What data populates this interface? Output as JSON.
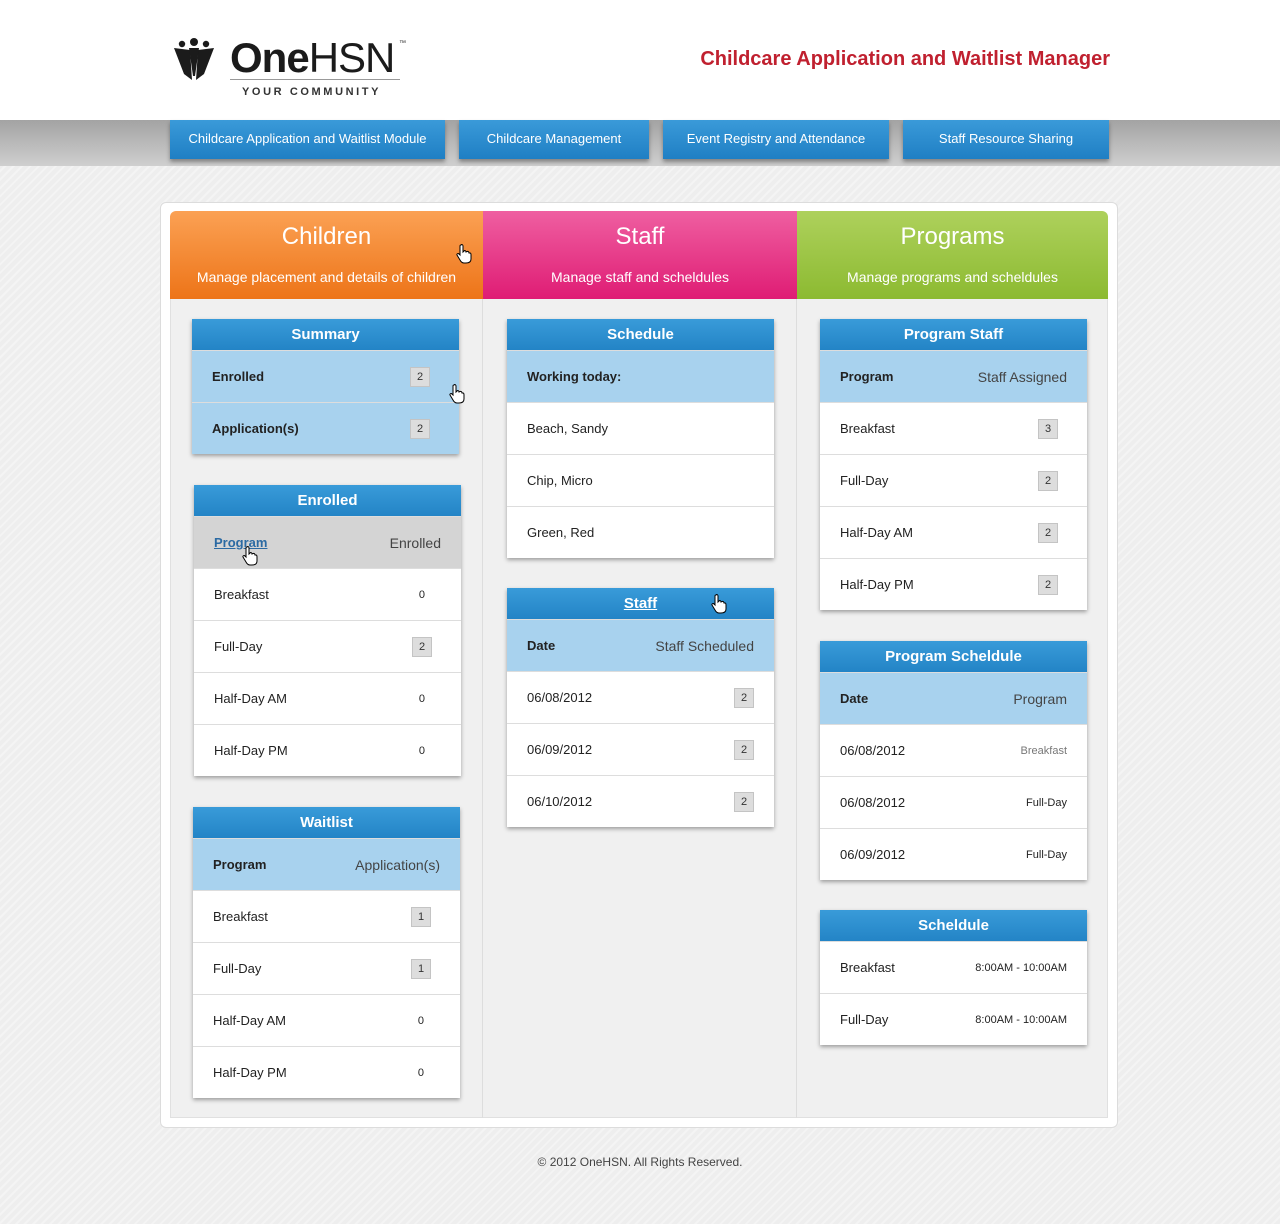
{
  "header": {
    "logo_one": "One",
    "logo_hsn": "HSN",
    "logo_tm": "™",
    "logo_tagline": "YOUR COMMUNITY",
    "app_title": "Childcare Application and Waitlist Manager"
  },
  "nav": [
    "Childcare Application and Waitlist Module",
    "Childcare Management",
    "Event Registry and Attendance",
    "Staff Resource Sharing"
  ],
  "columns": {
    "children": {
      "title": "Children",
      "subtitle": "Manage placement and details of children"
    },
    "staff": {
      "title": "Staff",
      "subtitle": "Manage staff and scheldules"
    },
    "programs": {
      "title": "Programs",
      "subtitle": "Manage programs and scheldules"
    }
  },
  "summary": {
    "title": "Summary",
    "rows": [
      {
        "label": "Enrolled",
        "count": "2"
      },
      {
        "label": "Application(s)",
        "count": "2"
      }
    ]
  },
  "enrolled": {
    "title": "Enrolled",
    "col_program": "Program",
    "col_value": "Enrolled",
    "rows": [
      {
        "program": "Breakfast",
        "count": "0"
      },
      {
        "program": "Full-Day",
        "count": "2"
      },
      {
        "program": "Half-Day AM",
        "count": "0"
      },
      {
        "program": "Half-Day PM",
        "count": "0"
      }
    ]
  },
  "waitlist": {
    "title": "Waitlist",
    "col_program": "Program",
    "col_value": "Application(s)",
    "rows": [
      {
        "program": "Breakfast",
        "count": "1"
      },
      {
        "program": "Full-Day",
        "count": "1"
      },
      {
        "program": "Half-Day AM",
        "count": "0"
      },
      {
        "program": "Half-Day PM",
        "count": "0"
      }
    ]
  },
  "staff_schedule": {
    "title": "Schedule",
    "subheader": "Working today:",
    "rows": [
      "Beach, Sandy",
      "Chip, Micro",
      "Green, Red"
    ]
  },
  "staff_table": {
    "title": "Staff",
    "col_date": "Date",
    "col_value": "Staff Scheduled",
    "rows": [
      {
        "date": "06/08/2012",
        "count": "2"
      },
      {
        "date": "06/09/2012",
        "count": "2"
      },
      {
        "date": "06/10/2012",
        "count": "2"
      }
    ]
  },
  "program_staff": {
    "title": "Program Staff",
    "col_program": "Program",
    "col_value": "Staff Assigned",
    "rows": [
      {
        "program": "Breakfast",
        "count": "3"
      },
      {
        "program": "Full-Day",
        "count": "2"
      },
      {
        "program": "Half-Day AM",
        "count": "2"
      },
      {
        "program": "Half-Day PM",
        "count": "2"
      }
    ]
  },
  "program_schedule": {
    "title": "Program Scheldule",
    "col_date": "Date",
    "col_value": "Program",
    "rows": [
      {
        "date": "06/08/2012",
        "program": "Breakfast"
      },
      {
        "date": "06/08/2012",
        "program": "Full-Day"
      },
      {
        "date": "06/09/2012",
        "program": "Full-Day"
      }
    ]
  },
  "program_times": {
    "title": "Scheldule",
    "rows": [
      {
        "program": "Breakfast",
        "time": "8:00AM - 10:00AM"
      },
      {
        "program": "Full-Day",
        "time": "8:00AM - 10:00AM"
      }
    ]
  },
  "footer": "© 2012 OneHSN. All Rights Reserved.",
  "colors": {
    "children": "#f08221",
    "staff": "#e3307f",
    "programs": "#98c141",
    "card_header": "#2b8ccf",
    "title_red": "#c0202f"
  }
}
